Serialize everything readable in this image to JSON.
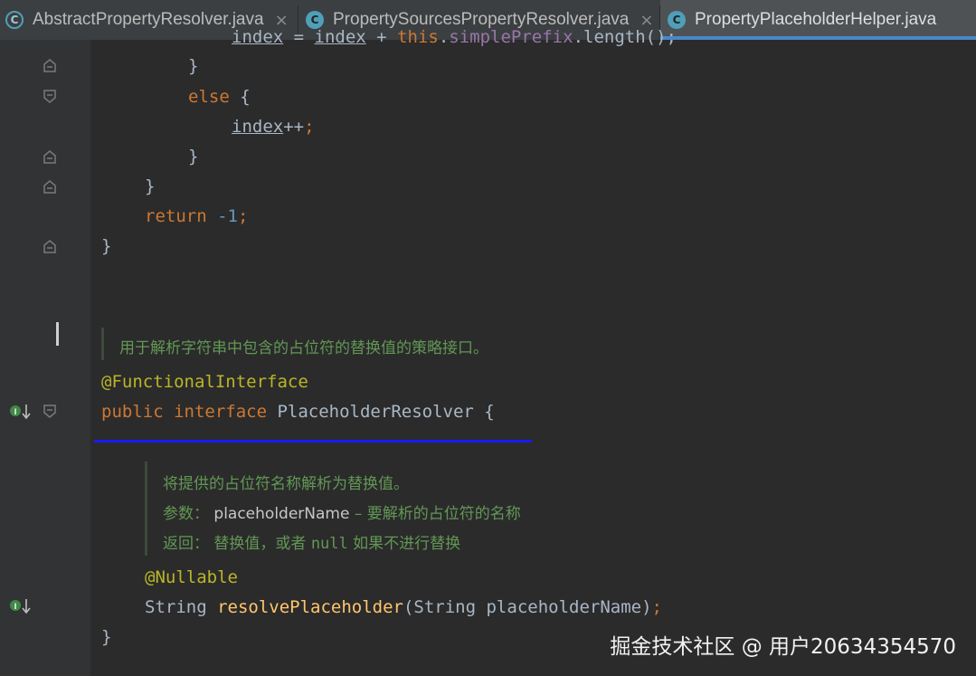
{
  "tabs": [
    {
      "label": "AbstractPropertyResolver.java",
      "icon": "abstract-class-icon",
      "active": false
    },
    {
      "label": "PropertySourcesPropertyResolver.java",
      "icon": "class-icon",
      "active": false
    },
    {
      "label": "PropertyPlaceholderHelper.java",
      "icon": "class-icon",
      "active": true
    }
  ],
  "tab_close_glyph": "×",
  "class_icon_glyph": "C",
  "code": {
    "l1_a": "index",
    "l1_b": " = ",
    "l1_c": "index",
    "l1_d": " + ",
    "l1_e": "this",
    "l1_f": ".",
    "l1_g": "simplePrefix",
    "l1_h": ".length();",
    "brace_close": "}",
    "else_kw": "else",
    "else_brace": " {",
    "index_var": "index",
    "index_inc": "++",
    "semicolon": ";",
    "return_kw": "return",
    "return_val": "-1",
    "annotation1": "@FunctionalInterface",
    "public_kw": "public",
    "interface_kw": "interface",
    "iface_name": " PlaceholderResolver {",
    "annotation2": "@Nullable",
    "string_type": "String ",
    "method_name": "resolvePlaceholder",
    "params": "(String placeholderName)",
    "final_brace": "}"
  },
  "doc1": "用于解析字符串中包含的占位符的替换值的策略接口。",
  "doc2": {
    "line1": "将提供的占位符名称解析为替换值。",
    "param_label": "参数：",
    "param_name": "placeholderName",
    "param_desc": " – 要解析的占位符的名称",
    "return_label": "返回：",
    "return_text1": "替换值，或者 ",
    "return_null": "null",
    "return_text2": " 如果不进行替换"
  },
  "watermark": "掘金技术社区 @ 用户20634354570",
  "colors": {
    "background": "#2b2b2b",
    "keyword": "#cc7832",
    "annotation": "#bbb529",
    "number": "#6897bb",
    "method": "#ffc66d",
    "doc_comment": "#629755",
    "accent": "#4a88c7"
  }
}
